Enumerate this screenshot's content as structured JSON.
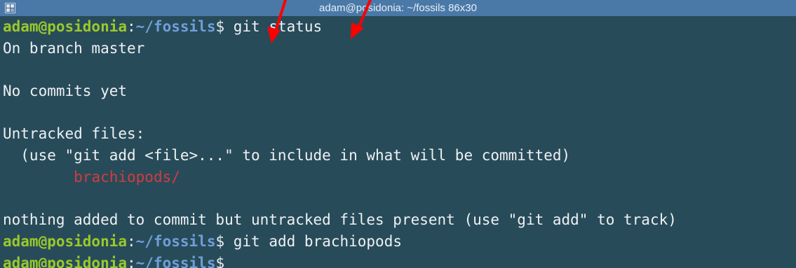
{
  "window": {
    "title": "adam@posidonia: ~/fossils 86x30",
    "icon": "terminal-app-icon"
  },
  "prompt": {
    "user_host": "adam@posidonia",
    "colon": ":",
    "path": "~/fossils",
    "dollar": "$"
  },
  "terminal": {
    "cmd1": " git status",
    "out_branch": "On branch master",
    "out_blank1": "",
    "out_commits": "No commits yet",
    "out_blank2": "",
    "out_untracked": "Untracked files:",
    "out_hint": "  (use \"git add <file>...\" to include in what will be committed)",
    "out_file": "\tbrachiopods/",
    "out_blank3": "",
    "out_nothing": "nothing added to commit but untracked files present (use \"git add\" to track)",
    "cmd2": " git add brachiopods",
    "cmd3": ""
  },
  "colors": {
    "terminal_bg": "#284b5a",
    "titlebar_bg": "#4a79a8",
    "user_host": "#9ac92a",
    "path": "#6f9fd8",
    "untracked_file": "#d13d3d",
    "annotation_arrow": "#ff0000"
  }
}
